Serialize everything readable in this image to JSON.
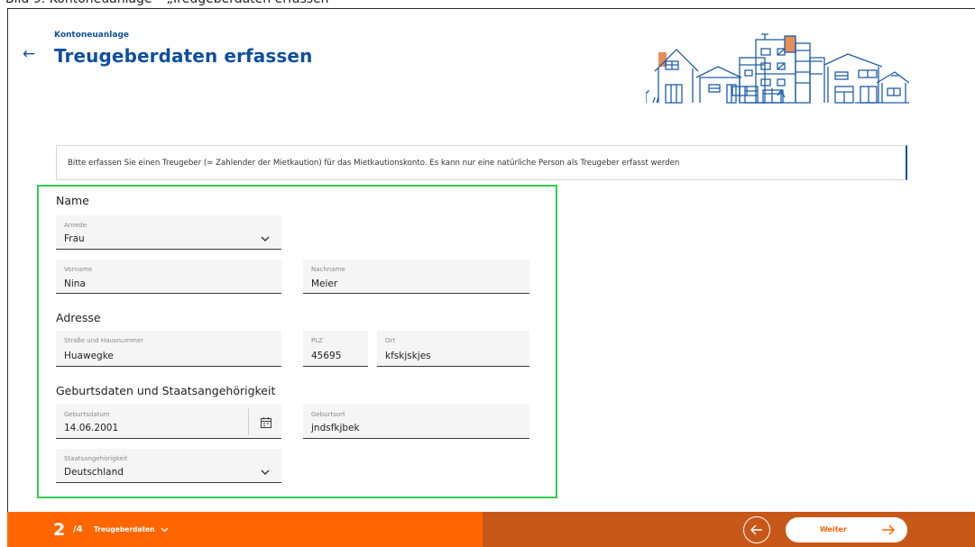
{
  "caption": "Bild 9: Kontoneuanlage – „Treugeberdaten erfassen“",
  "header": {
    "eyebrow": "Kontoneuanlage",
    "title": "Treugeberdaten erfassen"
  },
  "info": "Bitte erfassen Sie einen Treugeber (= Zahlender der Mietkaution) für das Mietkautionskonto. Es kann nur eine natürliche Person als Treugeber erfasst werden",
  "sections": {
    "name": "Name",
    "address": "Adresse",
    "birth": "Geburtsdaten und Staatsangehörigkeit"
  },
  "fields": {
    "anrede": {
      "label": "Anrede",
      "value": "Frau"
    },
    "vorname": {
      "label": "Vorname",
      "value": "Nina"
    },
    "nachname": {
      "label": "Nachname",
      "value": "Meier"
    },
    "strasse": {
      "label": "Straße und Hausnummer",
      "value": "Huawegke"
    },
    "plz": {
      "label": "PLZ",
      "value": "45695"
    },
    "ort": {
      "label": "Ort",
      "value": "kfskjskjes"
    },
    "geburtsdatum": {
      "label": "Geburtsdatum",
      "value": "14.06.2001"
    },
    "geburtsort": {
      "label": "Geburtsort",
      "value": "jndsfkjbek"
    },
    "staatsangehoerigkeit": {
      "label": "Staatsangehörigkeit",
      "value": "Deutschland"
    }
  },
  "footer": {
    "step_current": "2",
    "step_total": "/4",
    "step_name": "Treugeberdaten",
    "next_label": "Weiter"
  },
  "colors": {
    "brand_blue": "#0f4f9e",
    "brand_orange": "#ff6600",
    "footer_dark_orange": "#c8581a",
    "highlight_green": "#33cc4e"
  },
  "icons": {
    "back": "arrow-left-icon",
    "dropdown": "chevron-down-icon",
    "calendar": "calendar-icon",
    "nav_back": "circle-arrow-left-icon",
    "nav_next": "arrow-right-icon"
  }
}
